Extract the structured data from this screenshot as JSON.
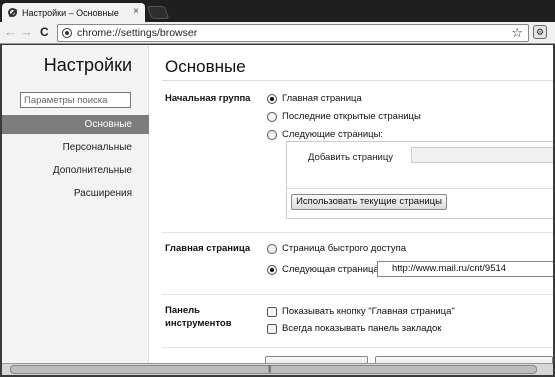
{
  "tab": {
    "title": "Настройки – Основные",
    "close": "×"
  },
  "toolbar": {
    "back": "←",
    "forward": "→",
    "reload": "C",
    "url": "chrome://settings/browser",
    "star": "☆",
    "menu": "⚙"
  },
  "sidebar": {
    "title": "Настройки",
    "search_placeholder": "Параметры поиска",
    "items": [
      {
        "label": "Основные",
        "active": true
      },
      {
        "label": "Персональные",
        "active": false
      },
      {
        "label": "Дополнительные",
        "active": false
      },
      {
        "label": "Расширения",
        "active": false
      }
    ]
  },
  "main": {
    "title": "Основные",
    "startup": {
      "label": "Начальная группа",
      "options": [
        {
          "label": "Главная страница",
          "selected": true
        },
        {
          "label": "Последние открытые страницы",
          "selected": false
        },
        {
          "label": "Следующие страницы:",
          "selected": false
        }
      ],
      "add_page_label": "Добавить страницу",
      "use_current_button": "Использовать текущие страницы"
    },
    "homepage": {
      "label": "Главная страница",
      "options": [
        {
          "label": "Страница быстрого доступа",
          "selected": false
        },
        {
          "label": "Следующая страница:",
          "selected": true
        }
      ],
      "url_value": "http://www.mail.ru/cnt/9514"
    },
    "toolbar_section": {
      "label_line1": "Панель",
      "label_line2": "инструментов",
      "options": [
        {
          "label": "Показывать кнопку \"Главная страница\"",
          "checked": false
        },
        {
          "label": "Всегда показывать панель закладок",
          "checked": false
        }
      ]
    }
  },
  "scrollbar": {
    "grip": "|||"
  }
}
